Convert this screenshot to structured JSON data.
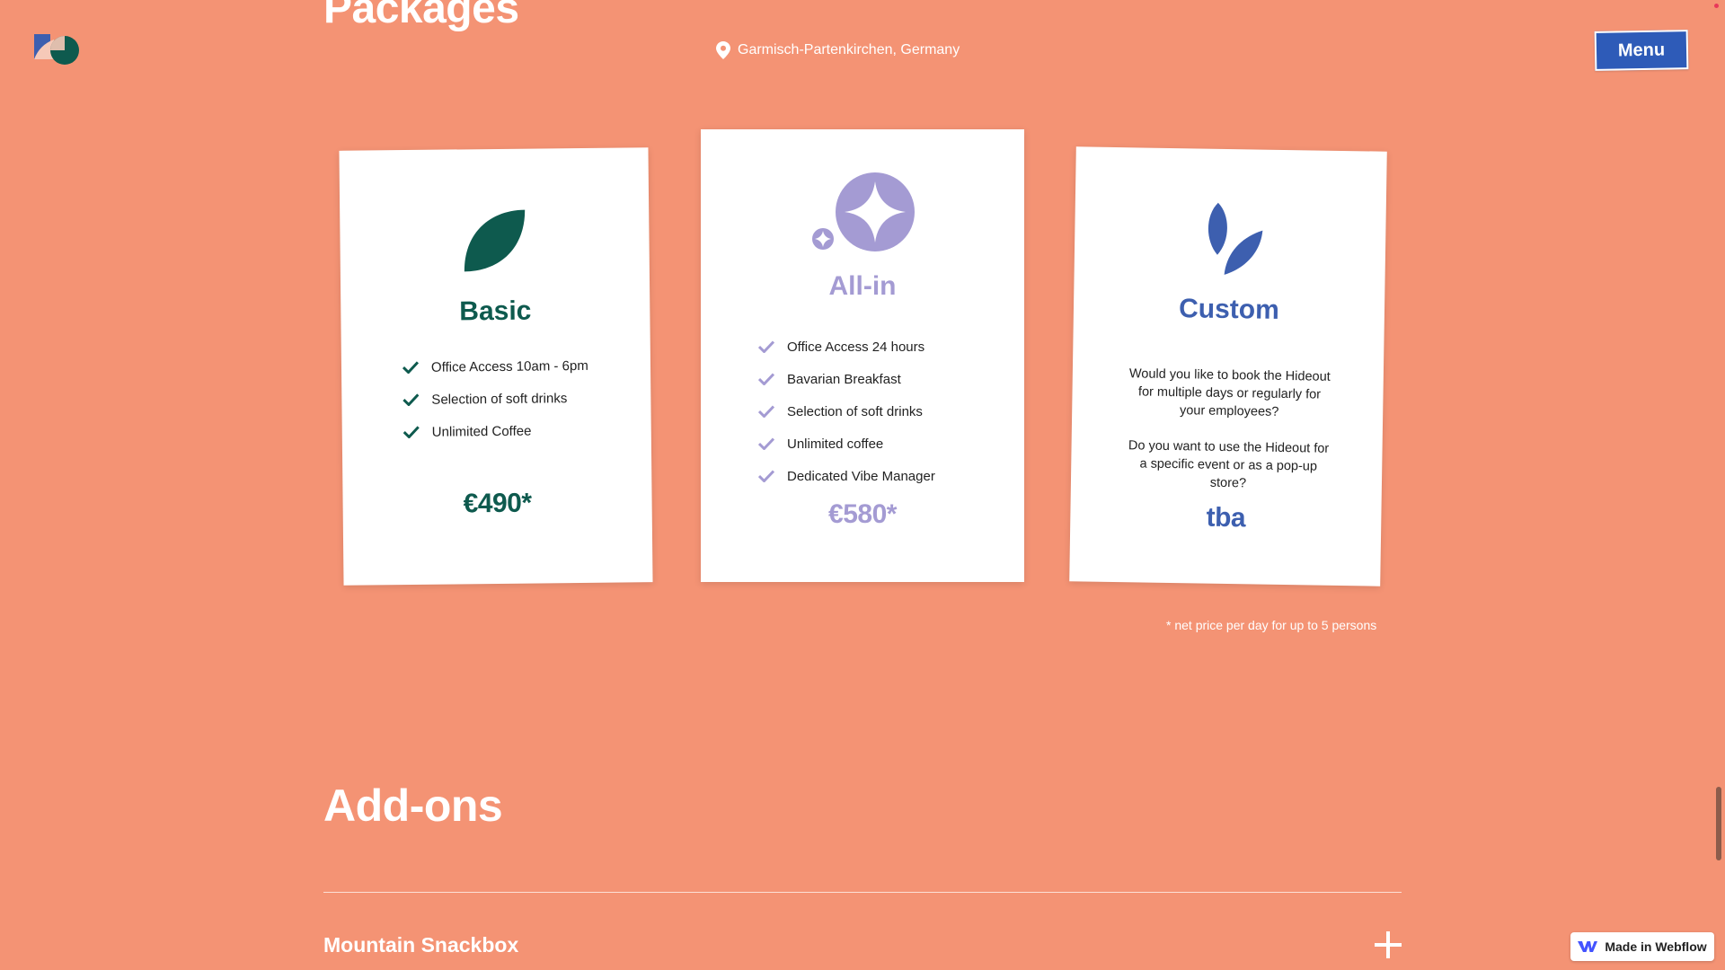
{
  "header": {
    "section_title": "Packages",
    "location": "Garmisch-Partenkirchen, Germany",
    "menu_label": "Menu"
  },
  "packages": [
    {
      "title": "Basic",
      "features": [
        "Office Access 10am - 6pm",
        "Selection of soft drinks",
        "Unlimited Coffee"
      ],
      "price": "€490*",
      "color": "#0E5A4E",
      "icon": "leaf-icon"
    },
    {
      "title": "All-in",
      "features": [
        "Office Access 24 hours",
        "Bavarian Breakfast",
        "Selection of soft drinks",
        "Unlimited coffee",
        "Dedicated Vibe Manager"
      ],
      "price": "€580*",
      "color": "#A49BD3",
      "icon": "sparkle-icon"
    },
    {
      "title": "Custom",
      "paragraphs": [
        "Would you like to book the Hideout for multiple days or regularly for your employees?",
        "Do you want to use the Hideout for a specific event or as a pop-up store?"
      ],
      "price": "tba",
      "color": "#3D5FAF",
      "icon": "double-leaf-icon"
    }
  ],
  "footnote": "* net price per day for up to 5 persons",
  "addons": {
    "title": "Add-ons",
    "items": [
      {
        "label": "Mountain Snackbox"
      }
    ]
  },
  "badge": {
    "label": "Made in Webflow"
  },
  "colors": {
    "background": "#F49374",
    "menu_button": "#2E5BB8"
  }
}
